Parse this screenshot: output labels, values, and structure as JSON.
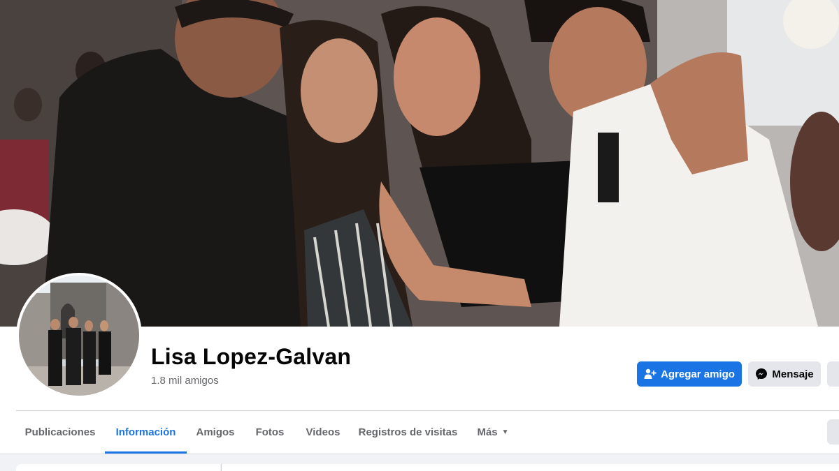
{
  "profile": {
    "name": "Lisa Lopez-Galvan",
    "friends_count": "1.8 mil amigos"
  },
  "actions": {
    "add_friend_label": "Agregar amigo",
    "message_label": "Mensaje"
  },
  "tabs": [
    {
      "label": "Publicaciones",
      "active": false
    },
    {
      "label": "Información",
      "active": true
    },
    {
      "label": "Amigos",
      "active": false
    },
    {
      "label": "Fotos",
      "active": false
    },
    {
      "label": "Videos",
      "active": false
    },
    {
      "label": "Registros de visitas",
      "active": false
    },
    {
      "label": "Más",
      "active": false
    }
  ],
  "colors": {
    "accent": "#1b74e4",
    "text_primary": "#050505",
    "text_secondary": "#65676b",
    "button_secondary_bg": "#e4e6eb",
    "page_bg": "#f0f2f5"
  },
  "icons": {
    "add_friend": "person-plus-icon",
    "message": "messenger-icon",
    "more_caret": "caret-down-icon"
  }
}
